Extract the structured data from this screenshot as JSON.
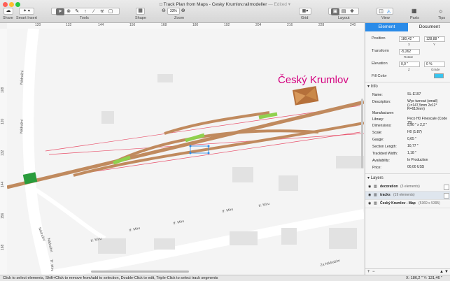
{
  "window": {
    "title": "Track Plan from Maps - Cesky Krumlov.railmodeller",
    "edited": "— Edited ▾",
    "traffic_colors": [
      "#ff5f57",
      "#febc2e",
      "#28c840"
    ]
  },
  "toolbar": {
    "share": "Share",
    "smart_insert": "Smart Insert",
    "tools": "Tools",
    "shape": "Shape",
    "zoom": "Zoom",
    "zoom_value": "33%",
    "grid": "Grid",
    "layout": "Layout",
    "view": "View",
    "parts": "Parts",
    "tips": "Tips"
  },
  "ruler": {
    "top": [
      "120",
      "132",
      "144",
      "156",
      "168",
      "180",
      "192",
      "204",
      "216",
      "228",
      "240"
    ],
    "left": [
      "108",
      "120",
      "132",
      "144",
      "156",
      "168"
    ]
  },
  "map": {
    "town_label": "Český Krumlov",
    "street_nadrazni": "Nádražní",
    "street_miru": "tř. Míru",
    "street_miru_short": "Tř. Míru",
    "street_za_nadrazim": "Za Nádražím",
    "accent": "#d4007f",
    "track_color": "#c08a5e"
  },
  "inspector": {
    "tab_element": "Element",
    "tab_document": "Document",
    "position_label": "Position",
    "position_x": "180,42 ˮ",
    "position_y": "128,88 ˮ",
    "x_label": "X",
    "y_label": "Y",
    "transform_label": "Transform",
    "rotate_value": "-5,262",
    "rotate_label": "Rotate",
    "elevation_label": "Elevation",
    "elevation_z": "0,0 ˮ",
    "grade_value": "0 %",
    "z_label": "Z",
    "grade_label": "Grade",
    "fill_color_label": "Fill Color",
    "fill_color": "#36c5f0",
    "info_header": "Info",
    "info": [
      {
        "k": "Name:",
        "v": "SL-E197"
      },
      {
        "k": "Description:",
        "v": "Wye turnout (small)\n(L=147,5mm 2x12°\nR=610mm)"
      },
      {
        "k": "Manufacturer:",
        "v": ""
      },
      {
        "k": "Library:",
        "v": "Peco H0 Finescale (Code 75)"
      },
      {
        "k": "Dimensions:",
        "v": "5,90 ˮ x 2,2 ˮ"
      },
      {
        "k": "Scale:",
        "v": "H0  (1:87)"
      },
      {
        "k": "Gauge:",
        "v": "0,65 ˮ"
      },
      {
        "k": "Section Length:",
        "v": "10,77 ˮ"
      },
      {
        "k": "Trackbed Width:",
        "v": "1,18 ˮ"
      },
      {
        "k": "Availability:",
        "v": "In Production"
      },
      {
        "k": "Price:",
        "v": "00,00 US$"
      }
    ],
    "layers_header": "Layers",
    "layers": [
      {
        "name": "decoration",
        "count": "(3 elements)"
      },
      {
        "name": "tracks",
        "count": "(19 elements)"
      },
      {
        "name": "Český Krumlov - Map",
        "count": "(5369 x 5395)"
      }
    ]
  },
  "status": {
    "hint": "Click to select elements, Shift+Click to remove from/add to selection, Double-Click to edit, Triple-Click to select track segments",
    "coords": "X: 186,2 ˮ  Y: 131,46 ˮ"
  }
}
